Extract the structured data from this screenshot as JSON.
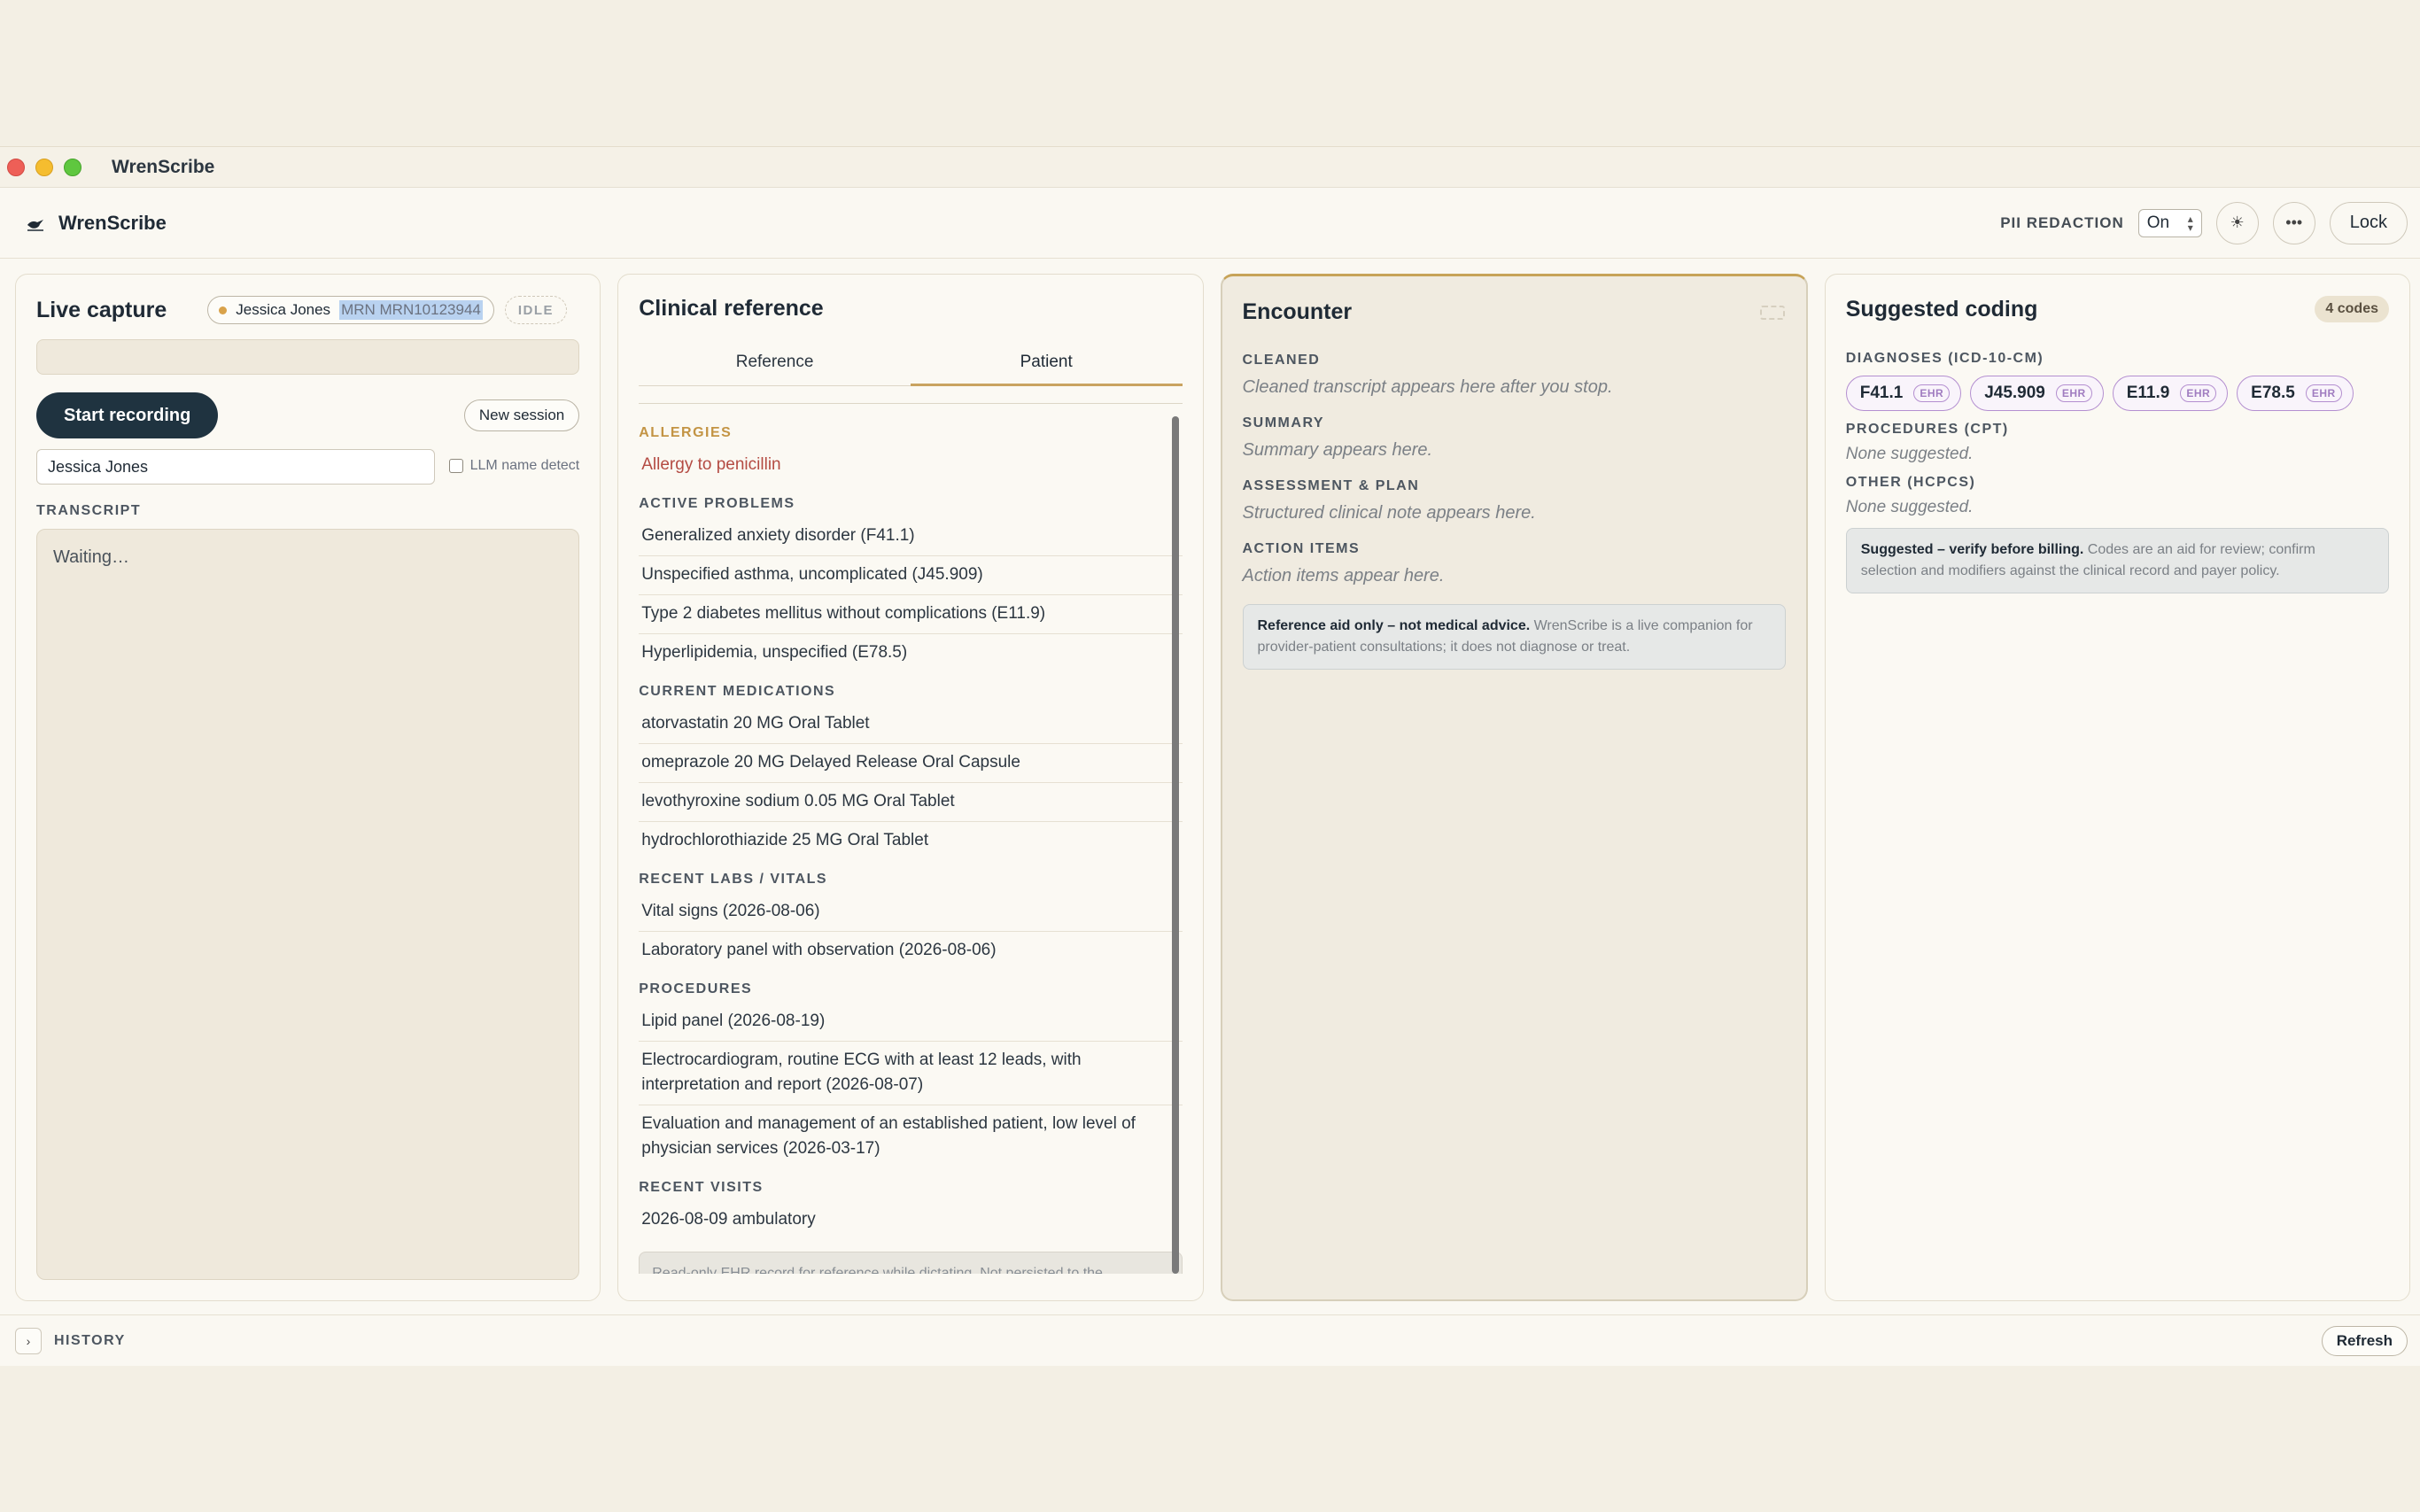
{
  "window": {
    "title": "WrenScribe"
  },
  "header": {
    "brand": "WrenScribe",
    "pii_label": "PII REDACTION",
    "pii_value": "On",
    "theme_icon": "sun-icon",
    "more_icon": "ellipsis-icon",
    "lock_label": "Lock"
  },
  "live_capture": {
    "title": "Live capture",
    "patient_name": "Jessica Jones",
    "mrn": "MRN MRN10123944",
    "status": "IDLE",
    "start_label": "Start recording",
    "new_session_label": "New session",
    "name_input_value": "Jessica Jones",
    "llm_detect_label": "LLM name detect",
    "transcript_label": "TRANSCRIPT",
    "transcript_text": "Waiting…"
  },
  "clinical_reference": {
    "title": "Clinical reference",
    "tabs": [
      {
        "label": "Reference",
        "active": false
      },
      {
        "label": "Patient",
        "active": true
      }
    ],
    "sections": [
      {
        "label": "ALLERGIES",
        "items": [
          "Allergy to penicillin"
        ]
      },
      {
        "label": "ACTIVE PROBLEMS",
        "items": [
          "Generalized anxiety disorder (F41.1)",
          "Unspecified asthma, uncomplicated (J45.909)",
          "Type 2 diabetes mellitus without complications (E11.9)",
          "Hyperlipidemia, unspecified (E78.5)"
        ]
      },
      {
        "label": "CURRENT MEDICATIONS",
        "items": [
          "atorvastatin 20 MG Oral Tablet",
          "omeprazole 20 MG Delayed Release Oral Capsule",
          "levothyroxine sodium 0.05 MG Oral Tablet",
          "hydrochlorothiazide 25 MG Oral Tablet"
        ]
      },
      {
        "label": "RECENT LABS / VITALS",
        "items": [
          "Vital signs (2026-08-06)",
          "Laboratory panel with observation (2026-08-06)"
        ]
      },
      {
        "label": "PROCEDURES",
        "items": [
          "Lipid panel (2026-08-19)",
          "Electrocardiogram, routine ECG with at least 12 leads, with interpretation and report (2026-08-07)",
          "Evaluation and management of an established patient, low level of physician services (2026-03-17)"
        ]
      },
      {
        "label": "RECENT VISITS",
        "items": [
          "2026-08-09 ambulatory"
        ]
      }
    ],
    "note": "Read-only EHR record for reference while dictating. Not persisted to the transcript."
  },
  "encounter": {
    "title": "Encounter",
    "sections": [
      {
        "label": "CLEANED",
        "text": "Cleaned transcript appears here after you stop."
      },
      {
        "label": "SUMMARY",
        "text": "Summary appears here."
      },
      {
        "label": "ASSESSMENT & PLAN",
        "text": "Structured clinical note appears here."
      },
      {
        "label": "ACTION ITEMS",
        "text": "Action items appear here."
      }
    ],
    "note_bold": "Reference aid only – not medical advice.",
    "note_text": " WrenScribe is a live companion for provider-patient consultations; it does not diagnose or treat."
  },
  "coding": {
    "title": "Suggested coding",
    "count_badge": "4 codes",
    "diagnoses_label": "DIAGNOSES (ICD-10-CM)",
    "diagnoses": [
      {
        "code": "F41.1",
        "tag": "EHR"
      },
      {
        "code": "J45.909",
        "tag": "EHR"
      },
      {
        "code": "E11.9",
        "tag": "EHR"
      },
      {
        "code": "E78.5",
        "tag": "EHR"
      }
    ],
    "procedures_label": "PROCEDURES (CPT)",
    "procedures_none": "None suggested.",
    "other_label": "OTHER (HCPCS)",
    "other_none": "None suggested.",
    "note_bold": "Suggested – verify before billing.",
    "note_text": " Codes are an aid for review; confirm selection and modifiers against the clinical record and payer policy."
  },
  "footer": {
    "history_label": "HISTORY",
    "refresh_label": "Refresh"
  },
  "colors": {
    "accent": "#c9a360",
    "primary_button": "#1f3340",
    "allergy": "#b44b43",
    "code_chip_border": "#b48fd0"
  }
}
